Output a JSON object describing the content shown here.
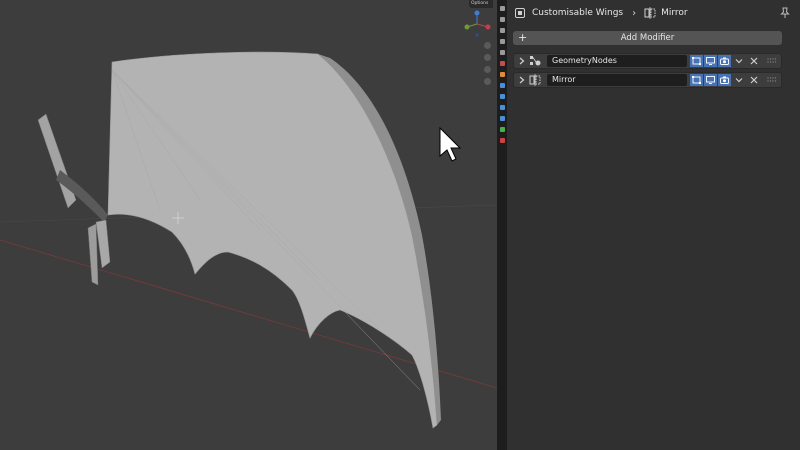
{
  "viewport": {
    "options_label": "Options",
    "gizmo_axes": [
      {
        "name": "X",
        "color": "#c83d4c"
      },
      {
        "name": "Y",
        "color": "#6e9b35"
      },
      {
        "name": "Z",
        "color": "#3d7fd6"
      }
    ],
    "nav_icons": [
      "zoom-icon",
      "pan-hand-icon",
      "camera-icon",
      "grid-icon"
    ]
  },
  "property_tabs": [
    {
      "name": "tool-tab-icon",
      "color": "#9a9a9a"
    },
    {
      "name": "render-tab-icon",
      "color": "#9a9a9a"
    },
    {
      "name": "output-tab-icon",
      "color": "#9a9a9a"
    },
    {
      "name": "view-layer-tab-icon",
      "color": "#9a9a9a"
    },
    {
      "name": "scene-tab-icon",
      "color": "#9a9a9a"
    },
    {
      "name": "world-tab-icon",
      "color": "#c0504d"
    },
    {
      "name": "object-tab-icon",
      "color": "#e08a3c"
    },
    {
      "name": "modifier-tab-icon",
      "color": "#4a90d9"
    },
    {
      "name": "particles-tab-icon",
      "color": "#4a90d9"
    },
    {
      "name": "physics-tab-icon",
      "color": "#4a90d9"
    },
    {
      "name": "constraints-tab-icon",
      "color": "#4a90d9"
    },
    {
      "name": "data-tab-icon",
      "color": "#4ab04a"
    },
    {
      "name": "material-tab-icon",
      "color": "#d04040"
    }
  ],
  "header": {
    "object_name": "Customisable Wings",
    "modifier_name": "Mirror"
  },
  "add_modifier_label": "Add Modifier",
  "modifiers": [
    {
      "name": "GeometryNodes",
      "icon": "geometry-nodes-icon"
    },
    {
      "name": "Mirror",
      "icon": "mirror-modifier-icon"
    }
  ],
  "colors": {
    "toggle_active": "#4772b3",
    "wing_mesh": "#b4b4b4",
    "x_axis": "#8a3b3b"
  }
}
